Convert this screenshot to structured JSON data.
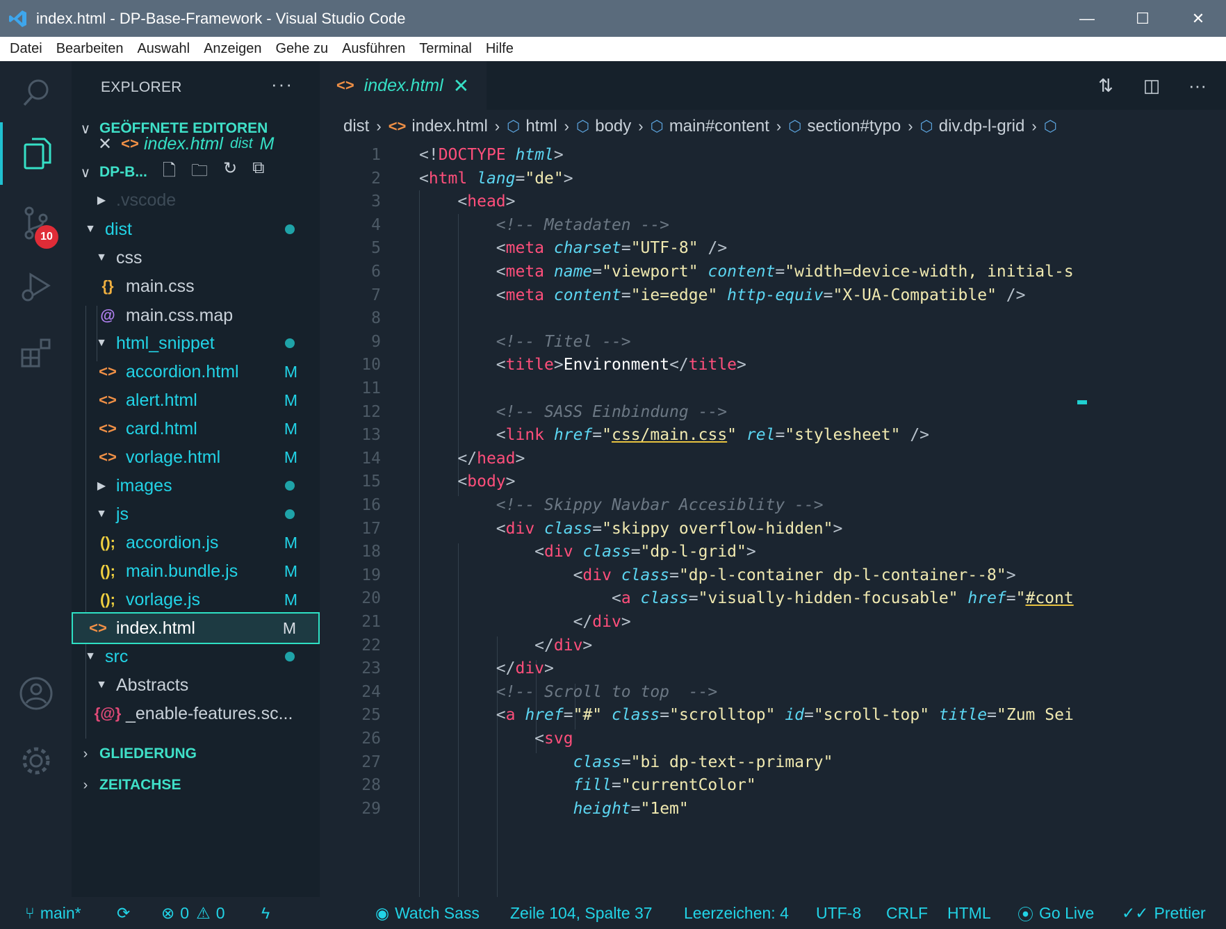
{
  "window": {
    "title": "index.html - DP-Base-Framework - Visual Studio Code"
  },
  "menu": [
    "Datei",
    "Bearbeiten",
    "Auswahl",
    "Anzeigen",
    "Gehe zu",
    "Ausführen",
    "Terminal",
    "Hilfe"
  ],
  "activity": {
    "icons": [
      "search-icon",
      "explorer-icon",
      "source-control-icon",
      "run-debug-icon",
      "extensions-icon",
      "account-icon",
      "settings-gear-icon"
    ],
    "scm_badge": "10"
  },
  "sidebar": {
    "header": "EXPLORER",
    "more": "···",
    "open_editors_title": "GEÖFFNETE EDITOREN",
    "open_editor": {
      "name": "index.html",
      "folder": "dist",
      "mark": "M"
    },
    "project_title": "DP-B...",
    "outline_title": "GLIEDERUNG",
    "timeline_title": "ZEITACHSE",
    "tree": [
      {
        "label": ".vscode",
        "kind": "folder-closed"
      },
      {
        "label": "dist",
        "kind": "folder-open",
        "dot": true
      },
      {
        "label": "css",
        "kind": "folder-open"
      },
      {
        "label": "main.css",
        "kind": "css",
        "icon": "{}"
      },
      {
        "label": "main.css.map",
        "kind": "map",
        "icon": "@"
      },
      {
        "label": "html_snippet",
        "kind": "folder-open",
        "dot": true
      },
      {
        "label": "accordion.html",
        "kind": "html",
        "icon": "<>",
        "mark": "M"
      },
      {
        "label": "alert.html",
        "kind": "html",
        "icon": "<>",
        "mark": "M"
      },
      {
        "label": "card.html",
        "kind": "html",
        "icon": "<>",
        "mark": "M"
      },
      {
        "label": "vorlage.html",
        "kind": "html",
        "icon": "<>",
        "mark": "M"
      },
      {
        "label": "images",
        "kind": "folder-closed",
        "dot": true
      },
      {
        "label": "js",
        "kind": "folder-open",
        "dot": true
      },
      {
        "label": "accordion.js",
        "kind": "js",
        "icon": "();",
        "mark": "M"
      },
      {
        "label": "main.bundle.js",
        "kind": "js",
        "icon": "();",
        "mark": "M"
      },
      {
        "label": "vorlage.js",
        "kind": "js",
        "icon": "();",
        "mark": "M"
      },
      {
        "label": "index.html",
        "kind": "html",
        "icon": "<>",
        "mark": "M",
        "selected": true
      },
      {
        "label": "src",
        "kind": "folder-open",
        "dot": true
      },
      {
        "label": "Abstracts",
        "kind": "folder-open"
      },
      {
        "label": "_enable-features.sc...",
        "kind": "scss",
        "icon": "{@}"
      }
    ]
  },
  "editor": {
    "tab": {
      "label": "index.html",
      "close": "✕"
    },
    "breadcrumb": [
      "dist",
      "index.html",
      "html",
      "body",
      "main#content",
      "section#typo",
      "div.dp-l-grid"
    ],
    "code": [
      "<!DOCTYPE html>",
      "<html lang=\"de\">",
      "    <head>",
      "        <!-- Metadaten -->",
      "        <meta charset=\"UTF-8\" />",
      "        <meta name=\"viewport\" content=\"width=device-width, initial-s",
      "        <meta content=\"ie=edge\" http-equiv=\"X-UA-Compatible\" />",
      "",
      "        <!-- Titel -->",
      "        <title>Environment</title>",
      "",
      "        <!-- SASS Einbindung -->",
      "        <link href=\"css/main.css\" rel=\"stylesheet\" />",
      "    </head>",
      "    <body>",
      "        <!-- Skippy Navbar Accesiblity -->",
      "        <div class=\"skippy overflow-hidden\">",
      "            <div class=\"dp-l-grid\">",
      "                <div class=\"dp-l-container dp-l-container--8\">",
      "                    <a class=\"visually-hidden-focusable\" href=\"#cont",
      "                </div>",
      "            </div>",
      "        </div>",
      "        <!-- Scroll to top  -->",
      "        <a href=\"#\" class=\"scrolltop\" id=\"scroll-top\" title=\"Zum Sei",
      "            <svg",
      "                class=\"bi dp-text--primary\"",
      "                fill=\"currentColor\"",
      "                height=\"1em\""
    ]
  },
  "status": {
    "branch": "main*",
    "sync": "⟳",
    "errors": "0",
    "warnings": "0",
    "watch_sass": "Watch Sass",
    "position": "Zeile 104, Spalte 37",
    "indent": "Leerzeichen: 4",
    "encoding": "UTF-8",
    "eol": "CRLF",
    "language": "HTML",
    "go_live": "Go Live",
    "prettier": "Prettier"
  },
  "colors": {
    "accent": "#22d3e6",
    "tag": "#ff4f7b",
    "attribute": "#5cd6f2",
    "string": "#f0e9b0",
    "html_icon": "#f09046",
    "badge": "#e02c37"
  }
}
